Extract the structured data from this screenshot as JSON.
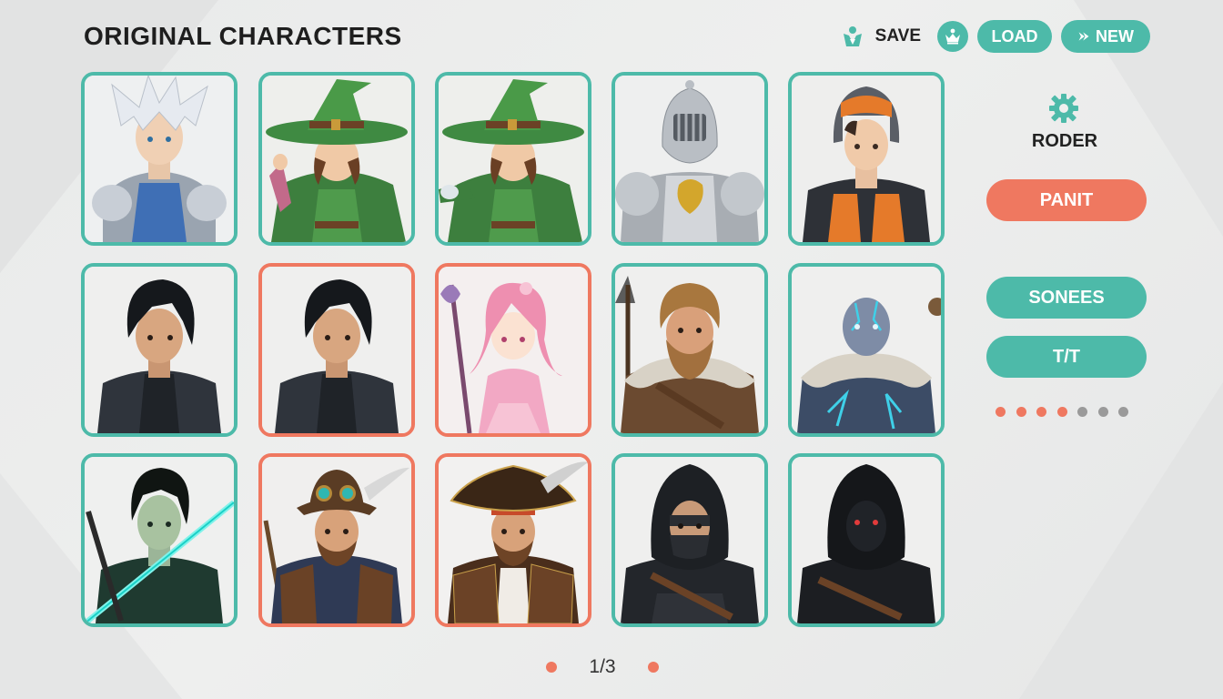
{
  "header": {
    "title": "ORIGINAL CHARACTERS",
    "save_label": "SAVE",
    "load_label": "LOAD",
    "new_label": "NEW"
  },
  "icons": {
    "save": "save-figure-icon",
    "crown": "crown-icon",
    "new": "arrow-icon",
    "gear": "gear-icon"
  },
  "characters": [
    {
      "portrait": "silver-haired-armored-hero",
      "selected": false
    },
    {
      "portrait": "green-witch-waving",
      "selected": false
    },
    {
      "portrait": "green-witch-reaching",
      "selected": false
    },
    {
      "portrait": "steel-knight-lion-crest",
      "selected": false
    },
    {
      "portrait": "pilot-orange-suit-helmet",
      "selected": false
    },
    {
      "portrait": "dark-haired-rogue",
      "selected": false
    },
    {
      "portrait": "dark-haired-rogue-alt",
      "selected": true
    },
    {
      "portrait": "pink-haired-mage-girl",
      "selected": true
    },
    {
      "portrait": "bearded-barbarian-axe",
      "selected": false
    },
    {
      "portrait": "blue-skinned-warrior-fur",
      "selected": false
    },
    {
      "portrait": "green-lit-swordsman",
      "selected": false
    },
    {
      "portrait": "steampunk-pirate-goggles",
      "selected": true
    },
    {
      "portrait": "pirate-captain",
      "selected": true
    },
    {
      "portrait": "hooded-assassin",
      "selected": false
    },
    {
      "portrait": "masked-shadow-ninja",
      "selected": false
    }
  ],
  "panel": {
    "label": "RODER",
    "primary_button": "PANIT",
    "button_2": "SONEES",
    "button_3": "T/T",
    "dots": [
      true,
      true,
      true,
      true,
      false,
      false,
      false
    ]
  },
  "pager": {
    "text": "1/3"
  },
  "colors": {
    "teal": "#4dbaa9",
    "coral": "#ef7860",
    "dot_inactive": "#9a9a9a"
  }
}
